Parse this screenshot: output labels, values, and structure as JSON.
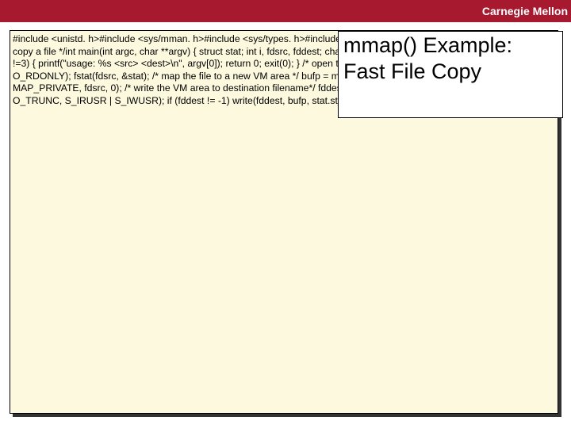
{
  "brand": "Carnegie Mellon",
  "title": "mmap() Example: Fast File Copy",
  "code_text": "#include <unistd. h>#include <sys/mman. h>#include <sys/types. h>#include <sys/stat. h>#include <fcntl. h>/* * Use mmap to copy a file */int main(int argc, char **argv) {  struct stat;  int i, fdsrc, fddest;  char *bufp;  /* Cursorly check arguments. */  if (argc !=3) {    printf(\"usage: %s <src> <dest>\\n\", argv[0]);    return 0;    exit(0);  }  /* open the file & get its size*/  fdsrc = open(argv[1], O_RDONLY);  fstat(fdsrc, &stat);  /* map the file to a new VM area */  bufp = mmap(0, stat.st_size, PROT_READ, MAP_PRIVATE, fdsrc, 0);  /* write the VM area to destination filename*/  fddest = open(argv[2], O_WRONLY | O_CREAT | O_TRUNC, S_IRUSR | S_IWUSR);  if (fddest != -1) write(fddest, bufp, stat.st_size);  exit(0);}"
}
